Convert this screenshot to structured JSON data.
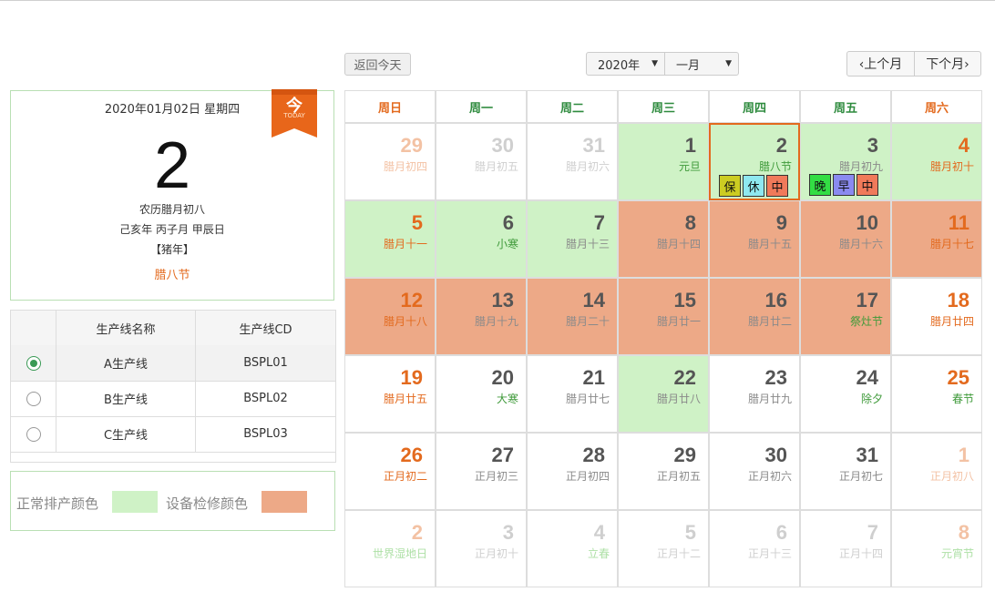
{
  "toolbar": {
    "back_today": "返回今天",
    "year_value": "2020年",
    "month_value": "一月",
    "prev_month": "‹上个月",
    "next_month": "下个月›"
  },
  "info": {
    "date_line": "2020年01月02日 星期四",
    "day_number": "2",
    "lunar": "农历腊月初八",
    "ganzhi": "己亥年 丙子月 甲辰日",
    "zodiac": "【猪年】",
    "festival": "腊八节",
    "today_char": "今",
    "today_en": "TODAY"
  },
  "table": {
    "headers": [
      "",
      "生产线名称",
      "生产线CD"
    ],
    "rows": [
      {
        "name": "A生产线",
        "code": "BSPL01",
        "selected": true
      },
      {
        "name": "B生产线",
        "code": "BSPL02",
        "selected": false
      },
      {
        "name": "C生产线",
        "code": "BSPL03",
        "selected": false
      }
    ]
  },
  "legend": {
    "normal_label": "正常排产颜色",
    "normal_color": "#cff2c6",
    "maint_label": "设备检修颜色",
    "maint_color": "#eda987"
  },
  "colors": {
    "accent_orange": "#e36a1e",
    "weekday_green": "#2e8b3e",
    "selected_border": "#e36a1e"
  },
  "calendar": {
    "weekdays": [
      {
        "label": "周日",
        "type": "weekend"
      },
      {
        "label": "周一",
        "type": "weekday"
      },
      {
        "label": "周二",
        "type": "weekday"
      },
      {
        "label": "周三",
        "type": "weekday"
      },
      {
        "label": "周四",
        "type": "weekday"
      },
      {
        "label": "周五",
        "type": "weekday"
      },
      {
        "label": "周六",
        "type": "weekend"
      }
    ],
    "weeks": [
      [
        {
          "day": "29",
          "lunar": "腊月初四",
          "bg": "white",
          "num": "fadeo",
          "lun": "fadeo"
        },
        {
          "day": "30",
          "lunar": "腊月初五",
          "bg": "white",
          "num": "fade",
          "lun": "fade"
        },
        {
          "day": "31",
          "lunar": "腊月初六",
          "bg": "white",
          "num": "fade",
          "lun": "fade"
        },
        {
          "day": "1",
          "lunar": "元旦",
          "bg": "green",
          "num": "dark",
          "lun": "green"
        },
        {
          "day": "2",
          "lunar": "腊八节",
          "bg": "green",
          "num": "dark",
          "lun": "green",
          "selected": true,
          "badges": [
            {
              "t": "保",
              "c": "#cccc22"
            },
            {
              "t": "休",
              "c": "#8ee8f0"
            },
            {
              "t": "中",
              "c": "#f07a5a"
            }
          ]
        },
        {
          "day": "3",
          "lunar": "腊月初九",
          "bg": "green",
          "num": "dark",
          "lun": "gray",
          "badges": [
            {
              "t": "晚",
              "c": "#33dd44"
            },
            {
              "t": "早",
              "c": "#8a8af0"
            },
            {
              "t": "中",
              "c": "#f07a5a"
            }
          ]
        },
        {
          "day": "4",
          "lunar": "腊月初十",
          "bg": "green",
          "num": "orange",
          "lun": "orange"
        }
      ],
      [
        {
          "day": "5",
          "lunar": "腊月十一",
          "bg": "green",
          "num": "orange",
          "lun": "orange"
        },
        {
          "day": "6",
          "lunar": "小寒",
          "bg": "green",
          "num": "dark",
          "lun": "green"
        },
        {
          "day": "7",
          "lunar": "腊月十三",
          "bg": "green",
          "num": "dark",
          "lun": "gray"
        },
        {
          "day": "8",
          "lunar": "腊月十四",
          "bg": "salmon",
          "num": "dark",
          "lun": "gray"
        },
        {
          "day": "9",
          "lunar": "腊月十五",
          "bg": "salmon",
          "num": "dark",
          "lun": "gray"
        },
        {
          "day": "10",
          "lunar": "腊月十六",
          "bg": "salmon",
          "num": "dark",
          "lun": "gray"
        },
        {
          "day": "11",
          "lunar": "腊月十七",
          "bg": "salmon",
          "num": "orange",
          "lun": "orange"
        }
      ],
      [
        {
          "day": "12",
          "lunar": "腊月十八",
          "bg": "salmon",
          "num": "orange",
          "lun": "orange"
        },
        {
          "day": "13",
          "lunar": "腊月十九",
          "bg": "salmon",
          "num": "dark",
          "lun": "gray"
        },
        {
          "day": "14",
          "lunar": "腊月二十",
          "bg": "salmon",
          "num": "dark",
          "lun": "gray"
        },
        {
          "day": "15",
          "lunar": "腊月廿一",
          "bg": "salmon",
          "num": "dark",
          "lun": "gray"
        },
        {
          "day": "16",
          "lunar": "腊月廿二",
          "bg": "salmon",
          "num": "dark",
          "lun": "gray"
        },
        {
          "day": "17",
          "lunar": "祭灶节",
          "bg": "salmon",
          "num": "dark",
          "lun": "green"
        },
        {
          "day": "18",
          "lunar": "腊月廿四",
          "bg": "white",
          "num": "orange",
          "lun": "orange"
        }
      ],
      [
        {
          "day": "19",
          "lunar": "腊月廿五",
          "bg": "white",
          "num": "orange",
          "lun": "orange"
        },
        {
          "day": "20",
          "lunar": "大寒",
          "bg": "white",
          "num": "dark",
          "lun": "green"
        },
        {
          "day": "21",
          "lunar": "腊月廿七",
          "bg": "white",
          "num": "dark",
          "lun": "gray"
        },
        {
          "day": "22",
          "lunar": "腊月廿八",
          "bg": "green",
          "num": "dark",
          "lun": "gray"
        },
        {
          "day": "23",
          "lunar": "腊月廿九",
          "bg": "white",
          "num": "dark",
          "lun": "gray"
        },
        {
          "day": "24",
          "lunar": "除夕",
          "bg": "white",
          "num": "dark",
          "lun": "green"
        },
        {
          "day": "25",
          "lunar": "春节",
          "bg": "white",
          "num": "orange",
          "lun": "green"
        }
      ],
      [
        {
          "day": "26",
          "lunar": "正月初二",
          "bg": "white",
          "num": "orange",
          "lun": "orange"
        },
        {
          "day": "27",
          "lunar": "正月初三",
          "bg": "white",
          "num": "dark",
          "lun": "gray"
        },
        {
          "day": "28",
          "lunar": "正月初四",
          "bg": "white",
          "num": "dark",
          "lun": "gray"
        },
        {
          "day": "29",
          "lunar": "正月初五",
          "bg": "white",
          "num": "dark",
          "lun": "gray"
        },
        {
          "day": "30",
          "lunar": "正月初六",
          "bg": "white",
          "num": "dark",
          "lun": "gray"
        },
        {
          "day": "31",
          "lunar": "正月初七",
          "bg": "white",
          "num": "dark",
          "lun": "gray"
        },
        {
          "day": "1",
          "lunar": "正月初八",
          "bg": "white",
          "num": "fadeo",
          "lun": "fadeo"
        }
      ],
      [
        {
          "day": "2",
          "lunar": "世界湿地日",
          "bg": "white",
          "num": "fadeo",
          "lun": "fadeg"
        },
        {
          "day": "3",
          "lunar": "正月初十",
          "bg": "white",
          "num": "fade",
          "lun": "fade"
        },
        {
          "day": "4",
          "lunar": "立春",
          "bg": "white",
          "num": "fade",
          "lun": "fadeg"
        },
        {
          "day": "5",
          "lunar": "正月十二",
          "bg": "white",
          "num": "fade",
          "lun": "fade"
        },
        {
          "day": "6",
          "lunar": "正月十三",
          "bg": "white",
          "num": "fade",
          "lun": "fade"
        },
        {
          "day": "7",
          "lunar": "正月十四",
          "bg": "white",
          "num": "fade",
          "lun": "fade"
        },
        {
          "day": "8",
          "lunar": "元宵节",
          "bg": "white",
          "num": "fadeo",
          "lun": "fadeg"
        }
      ]
    ]
  }
}
